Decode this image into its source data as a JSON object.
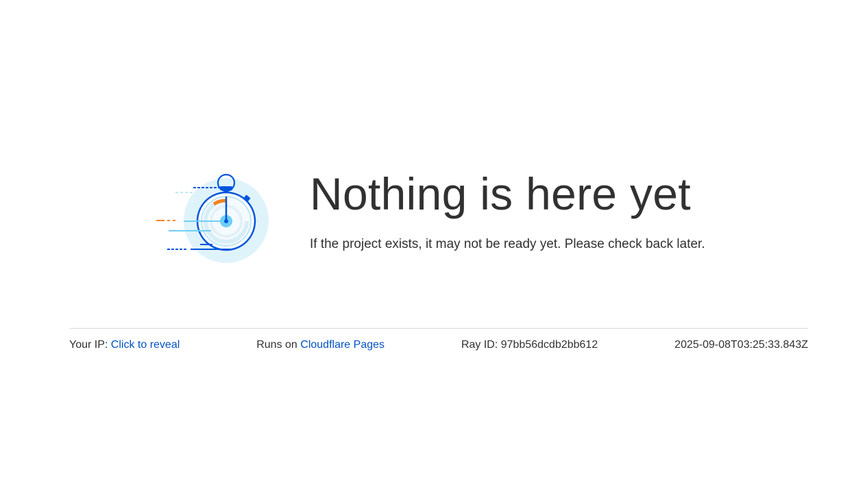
{
  "hero": {
    "title": "Nothing is here yet",
    "subtitle": "If the project exists, it may not be ready yet. Please check back later.",
    "illustration_icon": "stopwatch-icon"
  },
  "footer": {
    "ip_label": "Your IP:",
    "ip_link": "Click to reveal",
    "runs_on_label": "Runs on",
    "runs_on_link": "Cloudflare Pages",
    "ray_label": "Ray ID:",
    "ray_value": "97bb56dcdb2bb612",
    "timestamp": "2025-09-08T03:25:33.843Z"
  },
  "colors": {
    "text": "#313131",
    "link": "#0051c3",
    "accent_blue": "#0055dc",
    "accent_orange": "#f6821f",
    "light_blue": "#d9f1fb"
  }
}
